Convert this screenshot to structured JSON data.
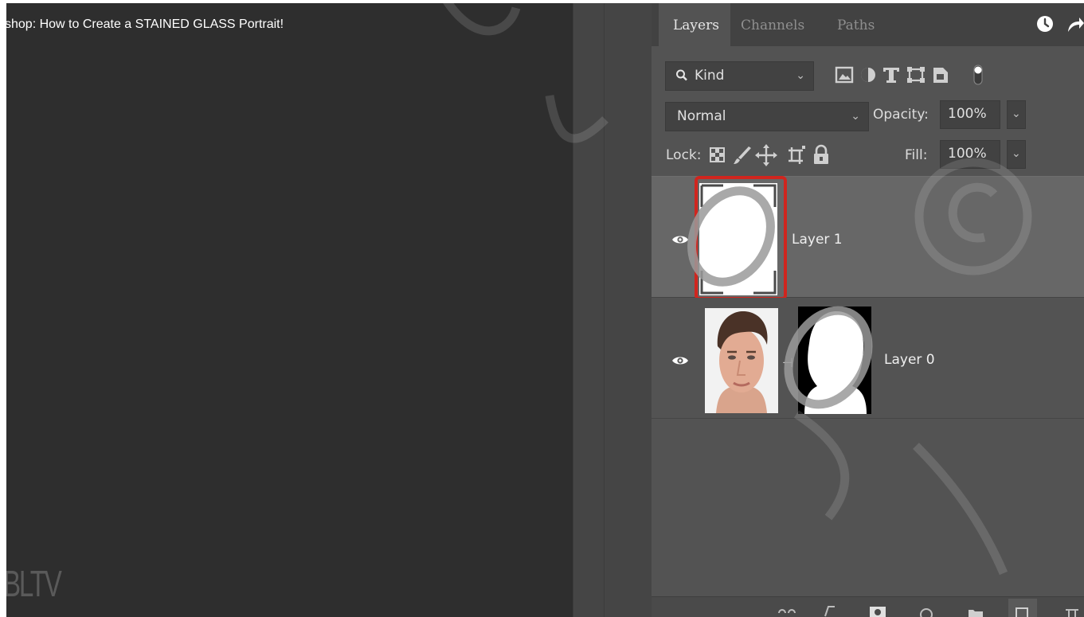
{
  "video": {
    "title": "shop: How to Create a STAINED GLASS Portrait!",
    "channel_logo": "BLTV",
    "top_icons": [
      "clock-icon",
      "share-arrow-icon"
    ]
  },
  "panel": {
    "tabs": [
      {
        "label": "Layers",
        "active": true
      },
      {
        "label": "Channels",
        "active": false
      },
      {
        "label": "Paths",
        "active": false
      }
    ],
    "filter": {
      "label": "Kind"
    },
    "filter_icons": [
      "image-filter-icon",
      "adjustment-filter-icon",
      "type-filter-icon",
      "shape-filter-icon",
      "smart-object-filter-icon",
      "filter-toggle-icon"
    ],
    "blend_mode": "Normal",
    "opacity_label": "Opacity:",
    "opacity_value": "100%",
    "lock_label": "Lock:",
    "lock_icons": [
      "lock-transparent-icon",
      "lock-paint-icon",
      "lock-move-icon",
      "lock-artboard-icon",
      "lock-all-icon"
    ],
    "fill_label": "Fill:",
    "fill_value": "100%",
    "layers": [
      {
        "name": "Layer 1",
        "visible": true,
        "selected": true
      },
      {
        "name": "Layer 0",
        "visible": true,
        "selected": false,
        "has_mask": true
      }
    ]
  },
  "colors": {
    "selection_outline": "#d0251e",
    "panel_bg": "#535353",
    "selected_row": "#676767"
  }
}
